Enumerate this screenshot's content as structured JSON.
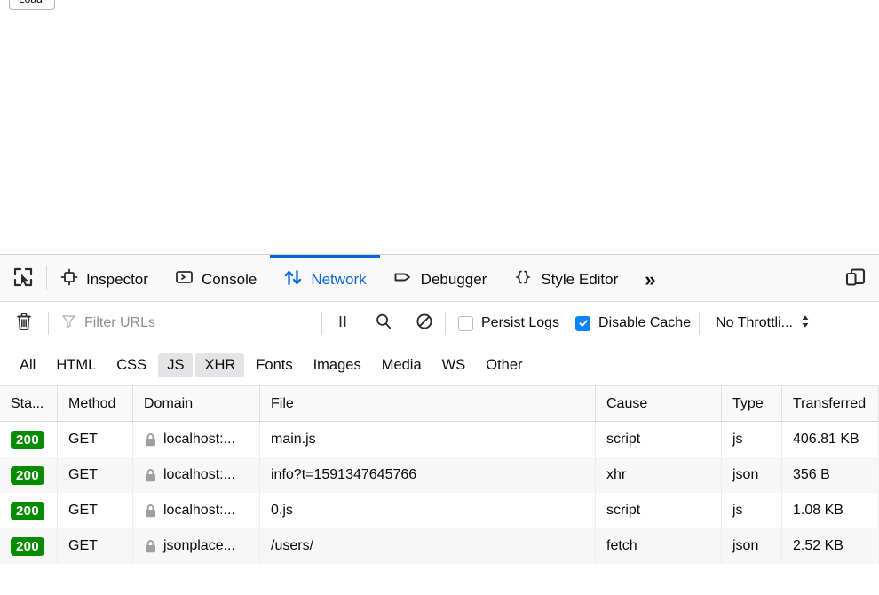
{
  "page": {
    "load_button_label": "Load!"
  },
  "devtools": {
    "tabs": [
      {
        "label": "Inspector",
        "icon": "inspector-icon",
        "active": false
      },
      {
        "label": "Console",
        "icon": "console-icon",
        "active": false
      },
      {
        "label": "Network",
        "icon": "network-arrows-icon",
        "active": true
      },
      {
        "label": "Debugger",
        "icon": "debugger-icon",
        "active": false
      },
      {
        "label": "Style Editor",
        "icon": "style-editor-icon",
        "active": false
      }
    ],
    "picker_icon": "element-picker-icon",
    "overflow_label": "»",
    "responsive_icon": "responsive-design-mode-icon",
    "accent_color": "#0a66d8"
  },
  "toolbar": {
    "trash_icon": "trash-icon",
    "filter_icon": "funnel-icon",
    "filter_placeholder": "Filter URLs",
    "filter_value": "",
    "pause_icon": "pause-icon",
    "search_icon": "search-icon",
    "block_icon": "block-icon",
    "persist_logs_label": "Persist Logs",
    "persist_logs_checked": false,
    "disable_cache_label": "Disable Cache",
    "disable_cache_checked": true,
    "throttle_label": "No Throttli...",
    "throttle_icon": "updown-arrows-icon",
    "checkbox_color": "#0a84ff"
  },
  "type_filters": [
    {
      "label": "All",
      "active": false
    },
    {
      "label": "HTML",
      "active": false
    },
    {
      "label": "CSS",
      "active": false
    },
    {
      "label": "JS",
      "active": true
    },
    {
      "label": "XHR",
      "active": true
    },
    {
      "label": "Fonts",
      "active": false
    },
    {
      "label": "Images",
      "active": false
    },
    {
      "label": "Media",
      "active": false
    },
    {
      "label": "WS",
      "active": false
    },
    {
      "label": "Other",
      "active": false
    }
  ],
  "table": {
    "columns": [
      {
        "key": "status",
        "label": "Sta..."
      },
      {
        "key": "method",
        "label": "Method"
      },
      {
        "key": "domain",
        "label": "Domain"
      },
      {
        "key": "file",
        "label": "File"
      },
      {
        "key": "cause",
        "label": "Cause"
      },
      {
        "key": "type",
        "label": "Type"
      },
      {
        "key": "transferred",
        "label": "Transferred"
      }
    ],
    "status_badge_color": "#058b00",
    "rows": [
      {
        "status": "200",
        "method": "GET",
        "domain": "localhost:...",
        "file": "main.js",
        "cause": "script",
        "type": "js",
        "transferred": "406.81 KB",
        "secure": true
      },
      {
        "status": "200",
        "method": "GET",
        "domain": "localhost:...",
        "file": "info?t=1591347645766",
        "cause": "xhr",
        "type": "json",
        "transferred": "356 B",
        "secure": true
      },
      {
        "status": "200",
        "method": "GET",
        "domain": "localhost:...",
        "file": "0.js",
        "cause": "script",
        "type": "js",
        "transferred": "1.08 KB",
        "secure": true
      },
      {
        "status": "200",
        "method": "GET",
        "domain": "jsonplace...",
        "file": "/users/",
        "cause": "fetch",
        "type": "json",
        "transferred": "2.52 KB",
        "secure": true
      }
    ]
  }
}
